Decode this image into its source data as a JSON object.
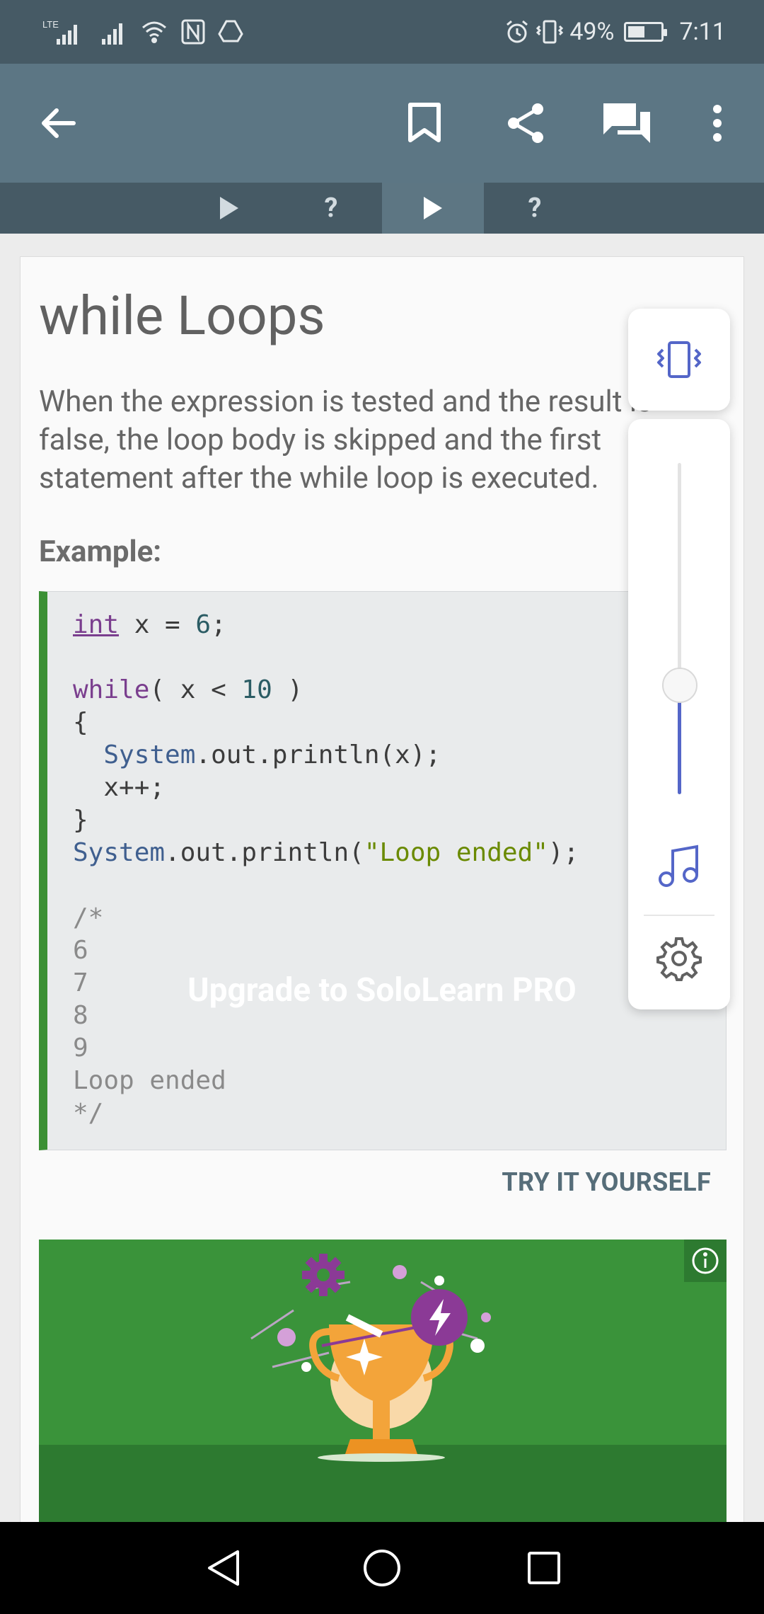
{
  "status_bar": {
    "network_label": "LTE",
    "battery_percent": "49%",
    "time": "7:11",
    "battery_level": 0.49
  },
  "app_bar": {
    "icons": [
      "back-arrow-icon",
      "bookmark-icon",
      "share-icon",
      "comments-icon",
      "more-vert-icon"
    ]
  },
  "tabs": [
    {
      "label": "▶",
      "active": false
    },
    {
      "label": "?",
      "active": false
    },
    {
      "label": "▶",
      "active": true
    },
    {
      "label": "?",
      "active": false
    }
  ],
  "lesson": {
    "title": "while Loops",
    "text": "When the expression is tested and the result is false, the loop body is skipped and the first statement after the while loop is executed.",
    "example_label": "Example:",
    "try_label": "TRY IT YOURSELF"
  },
  "promo": {
    "title": "Upgrade to SoloLearn PRO"
  },
  "volume": {
    "level": 0.33,
    "icons": [
      "vibrate-icon",
      "music-note-icon",
      "settings-gear-icon"
    ]
  },
  "colors": {
    "status_bar": "#465a65",
    "app_bar": "#5c7684",
    "code_accent": "#3b9034",
    "promo": "#3a933a",
    "slider_accent": "#5466c8"
  }
}
